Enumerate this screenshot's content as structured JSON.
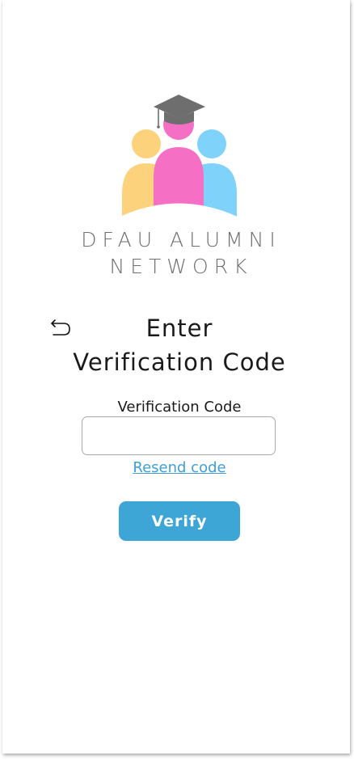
{
  "brand": {
    "line1": "DFAU ALUMNI",
    "line2": "NETWORK",
    "logo_icon": "alumni-group-graduation-cap-logo",
    "colors": {
      "yellow": "#fdd27d",
      "pink": "#f56fc4",
      "blue": "#7fd3fb",
      "cap": "#6e6e6e"
    }
  },
  "header": {
    "back_icon": "undo-arrow-icon",
    "title_line1": "Enter",
    "title_line2": "Verification Code"
  },
  "form": {
    "field_label": "Verification Code",
    "input_value": "",
    "input_placeholder": "",
    "resend_label": "Resend code",
    "verify_label": "Verify"
  },
  "colors": {
    "accent": "#3ea6d6",
    "link": "#3f9fd3"
  }
}
